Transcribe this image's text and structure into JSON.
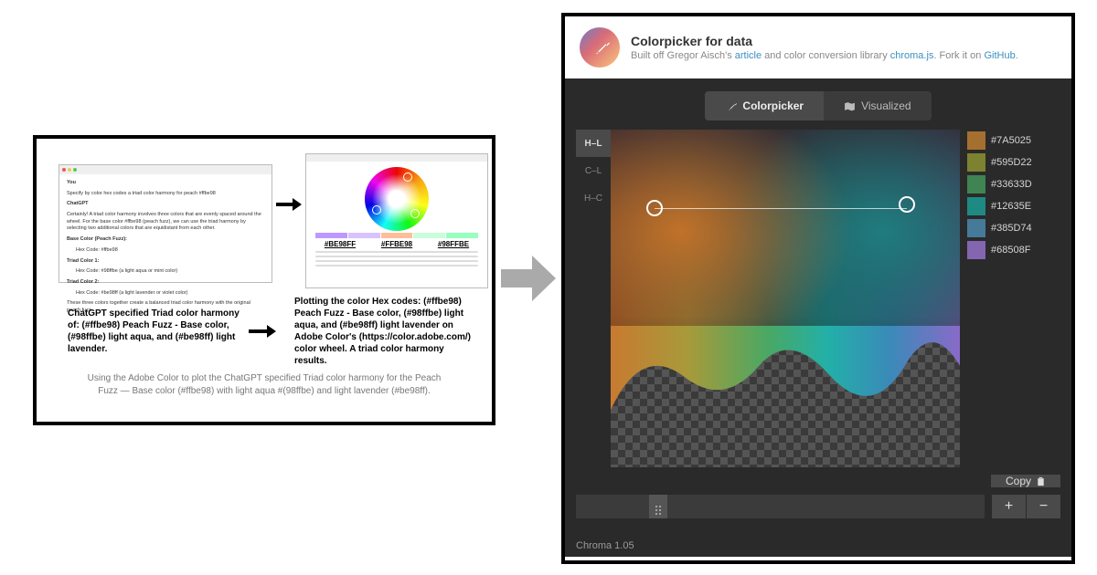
{
  "left": {
    "chat": {
      "user_label": "You",
      "user_msg": "Specify by color hex codes a triad color harmony for peach #ffbe98",
      "bot_label": "ChatGPT",
      "bot_msg": "Certainly! A triad color harmony involves three colors that are evenly spaced around the wheel. For the base color #ffbe98 (peach fuzz), we can use the triad harmony by selecting two additional colors that are equidistant from each other.",
      "base_title": "Base Color (Peach Fuzz):",
      "base_line": "Hex Code: #ffbe98",
      "triad1_title": "Triad Color 1:",
      "triad1_line": "Hex Code: #98ffbe (a light aqua or mint color)",
      "triad2_title": "Triad Color 2:",
      "triad2_line": "Hex Code: #be98ff (a light lavender or violet color)",
      "chat_footer": "These three colors together create a balanced triad color harmony with the original peach fuzz."
    },
    "hex1": "#BE98FF",
    "hex2": "#FFBE98",
    "hex3": "#98FFBE",
    "desc_left": "ChatGPT specified Triad color harmony of: (#ffbe98) Peach Fuzz - Base color, (#98ffbe) light aqua, and (#be98ff) light lavender.",
    "desc_right": "Plotting the color Hex codes: (#ffbe98) Peach Fuzz - Base color, (#98ffbe) light aqua, and (#be98ff) light lavender on Adobe Color's (https://color.adobe.com/) color wheel.  A triad color harmony results.",
    "caption": "Using the Adobe Color to plot the ChatGPT specified Triad color harmony for the Peach Fuzz — Base color (#ffbe98) with light aqua #(98ffbe) and light lavender (#be98ff)."
  },
  "app": {
    "title": "Colorpicker for data",
    "subtitle_pre": "Built off Gregor Aisch's ",
    "link1": "article",
    "subtitle_mid": " and color conversion library ",
    "link2": "chroma.js",
    "subtitle_post": ". Fork it on ",
    "link3": "GitHub",
    "subtitle_end": ".",
    "tabs": {
      "picker": "Colorpicker",
      "viz": "Visualized"
    },
    "axes": [
      "H–L",
      "C–L",
      "H–C"
    ],
    "legend": [
      {
        "hex": "#7A5025",
        "color": "#a5702f"
      },
      {
        "hex": "#595D22",
        "color": "#7c8230"
      },
      {
        "hex": "#33633D",
        "color": "#3f8452"
      },
      {
        "hex": "#12635E",
        "color": "#1e8a83"
      },
      {
        "hex": "#385D74",
        "color": "#467a99"
      },
      {
        "hex": "#68508F",
        "color": "#8365b0"
      }
    ],
    "copy": "Copy",
    "plus": "+",
    "minus": "−",
    "status": "Chroma 1.05"
  }
}
